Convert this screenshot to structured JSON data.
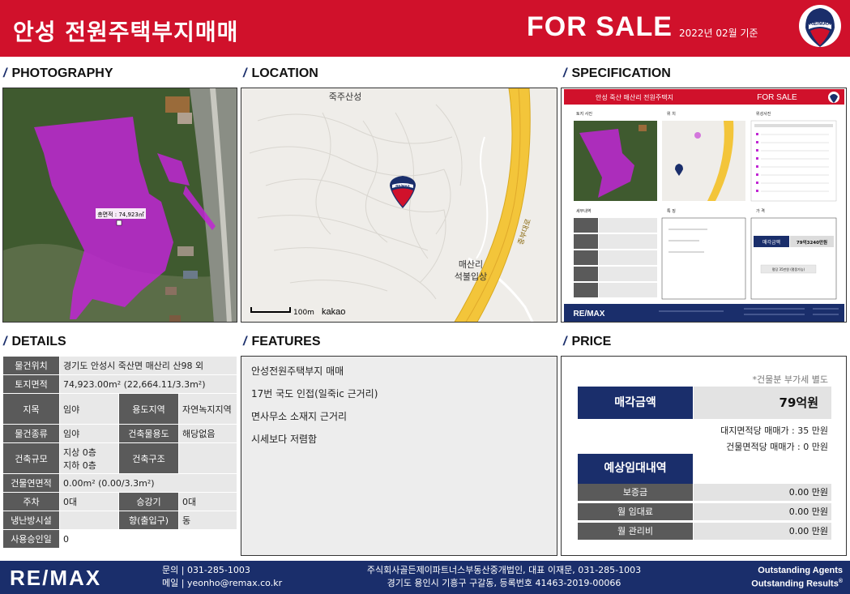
{
  "header": {
    "title": "안성 전원주택부지매매",
    "for_sale": "FOR SALE",
    "as_of": "2022년 02월 기준",
    "logo_text": "RE/MAX"
  },
  "sections": {
    "photography": "PHOTOGRAPHY",
    "location": "LOCATION",
    "specification": "SPECIFICATION",
    "details": "DETAILS",
    "features": "FEATURES",
    "price": "PRICE"
  },
  "photo": {
    "area_label": "총면적 : 74,923㎡"
  },
  "map": {
    "place_top": "죽주산성",
    "place_village_1": "매산리",
    "place_village_2": "석불입상",
    "road_label": "중부대로",
    "scale": "100m",
    "provider": "kakao"
  },
  "spec_thumb": {
    "title": "안성 죽산 매산리 전원주택지",
    "for_sale": "FOR SALE",
    "sub_photo": "토지 사진",
    "sub_location": "위 치",
    "sub_history": "위성사진",
    "sub_details": "세부내역",
    "sub_features": "특 징",
    "sub_price": "가 격",
    "price_label": "매각금액",
    "price_value": "79억3240만원",
    "price_note": "평당 35만원 (평뭉가능)",
    "footer_brand": "RE/MAX"
  },
  "details": {
    "address_label": "물건위치",
    "address_value": "경기도 안성시 죽산면 매산리 산98 외",
    "land_area_label": "토지면적",
    "land_area_value": "74,923.00m² (22,664.11/3.3m²)",
    "jimok_label": "지목",
    "jimok_value": "임야",
    "zone_label": "용도지역",
    "zone_value": "자연녹지지역",
    "type_label": "물건종류",
    "type_value": "임야",
    "use_label": "건축물용도",
    "use_value": "해당없음",
    "scale_label": "건축규모",
    "scale_value_1": "지상 0층",
    "scale_value_2": "지하 0층",
    "structure_label": "건축구조",
    "structure_value": "",
    "floor_area_label": "건물연면적",
    "floor_area_value": "0.00m² (0.00/3.3m²)",
    "parking_label": "주차",
    "parking_value": "0대",
    "elevator_label": "승강기",
    "elevator_value": "0대",
    "hvac_label": "냉난방시설",
    "hvac_value": "",
    "direction_label": "향(출입구)",
    "direction_value": "동",
    "approval_label": "사용승인일",
    "approval_value": "0"
  },
  "features": {
    "items": [
      "안성전원주택부지 매매",
      "17번 국도 인접(일죽ic 근거리)",
      "면사무소 소재지 근거리",
      "시세보다 저렴함"
    ]
  },
  "price": {
    "vat_note": "*건물분 부가세 별도",
    "sale_label": "매각금액",
    "sale_value": "79억원",
    "land_unit_price": "대지면적당 매매가 : 35 만원",
    "building_unit_price": "건물면적당 매매가 : 0 만원",
    "rent_label": "예상임대내역",
    "deposit_label": "보증금",
    "deposit_value": "0.00 만원",
    "monthly_label": "월 임대료",
    "monthly_value": "0.00 만원",
    "maint_label": "월 관리비",
    "maint_value": "0.00 만원"
  },
  "footer": {
    "brand": "RE/MAX",
    "phone_line": "문의 | 031-285-1003",
    "email_line": "메일 | yeonho@remax.co.kr",
    "company_line": "주식회사골든제이파트너스부동산중개법인, 대표 이재문, 031-285-1003",
    "address_line": "경기도 용인시 기흥구 구갈동, 등록번호 41463-2019-00066",
    "slogan_1": "Outstanding Agents",
    "slogan_2": "Outstanding Results"
  },
  "colors": {
    "header_red": "#d0112b",
    "navy": "#1a2e6b",
    "parcel_magenta": "#c026d3"
  }
}
